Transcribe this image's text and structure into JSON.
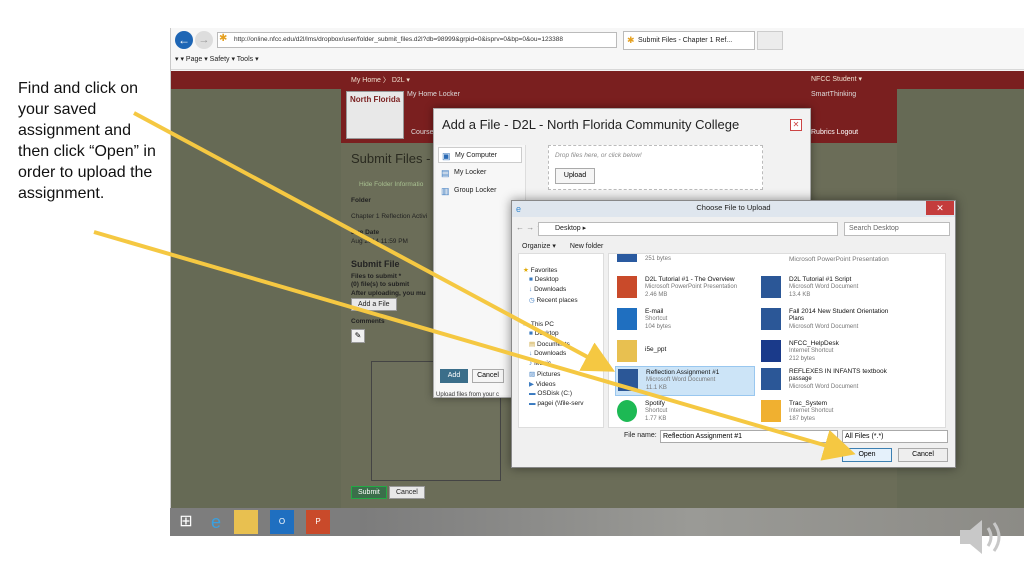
{
  "instruction": "Find and click on your saved assignment and then click “Open” in order to upload the assignment.",
  "browser": {
    "address": "http://online.nfcc.edu/d2l/lms/dropbox/user/folder_submit_files.d2l?db=98999&grpid=0&isprv=0&bp=0&ou=123388",
    "tab_title": "Submit Files - Chapter 1 Ref...",
    "command_bar": "▾  ▾  Page ▾  Safety ▾  Tools ▾"
  },
  "d2l": {
    "top_left": "My Home  〉 D2L  ▾",
    "top_right": "NFCC Student ▾",
    "logo_text": "North Florida",
    "home_locker": "My Home  Locker",
    "smart_thinking": "SmartThinking",
    "course_home": "Course H",
    "rubrics_logout": "Rubrics  Logout",
    "submit_title": "Submit Files - C",
    "hide_folder": "Hide Folder Informatio",
    "folder_label": "Folder",
    "folder_value": "Chapter 1 Reflection Activi",
    "due_label": "Due Date",
    "due_value": "Aug 2014 11:59 PM",
    "submit_files": "Submit File",
    "files_to_submit": "Files to submit *",
    "files_count": "(0) file(s) to submit",
    "after_upload": "After uploading, you mu",
    "add_file": "Add a File",
    "comments": "Comments",
    "submit_btn": "Submit",
    "cancel_btn": "Cancel"
  },
  "add_file_dialog": {
    "title": "Add a File - D2L - North Florida Community College",
    "nav": [
      "My Computer",
      "My Locker",
      "Group Locker"
    ],
    "drop_text": "Drop files here, or click below!",
    "upload": "Upload",
    "add": "Add",
    "cancel": "Cancel",
    "note": "Upload files from your c"
  },
  "choose_dialog": {
    "title": "Choose File to Upload",
    "path": "Desktop  ▸",
    "search_placeholder": "Search Desktop",
    "organize": "Organize ▾",
    "new_folder": "New folder",
    "tree": [
      "Favorites",
      "Desktop",
      "Downloads",
      "Recent places",
      "This PC",
      "Desktop",
      "Documents",
      "Downloads",
      "Music",
      "Pictures",
      "Videos",
      "OSDisk (C:)",
      "pagei (\\\\file-serv"
    ],
    "files_left": [
      {
        "name": "",
        "meta1": "251 bytes",
        "meta2": ""
      },
      {
        "name": "D2L Tutorial #1 - The Overview",
        "meta1": "Microsoft PowerPoint Presentation",
        "meta2": "2.46 MB"
      },
      {
        "name": "E-mail",
        "meta1": "Shortcut",
        "meta2": "104 bytes"
      },
      {
        "name": "i5e_ppt",
        "meta1": "",
        "meta2": ""
      },
      {
        "name": "Reflection Assignment #1",
        "meta1": "Microsoft Word Document",
        "meta2": "11.1 KB"
      },
      {
        "name": "Spotify",
        "meta1": "Shortcut",
        "meta2": "1.77 KB"
      }
    ],
    "files_right": [
      {
        "name": "Microsoft PowerPoint Presentation",
        "meta1": "",
        "meta2": ""
      },
      {
        "name": "D2L Tutorial #1 Script",
        "meta1": "Microsoft Word Document",
        "meta2": "13.4 KB"
      },
      {
        "name": "Fall 2014 New Student Orientation",
        "meta1": "Plans",
        "meta2": "Microsoft Word Document"
      },
      {
        "name": "NFCC_HelpDesk",
        "meta1": "Internet Shortcut",
        "meta2": "212 bytes"
      },
      {
        "name": "REFLEXES IN INFANTS textbook",
        "meta1": "passage",
        "meta2": "Microsoft Word Document"
      },
      {
        "name": "Trac_System",
        "meta1": "Internet Shortcut",
        "meta2": "187 bytes"
      }
    ],
    "file_name_label": "File name:",
    "file_name_value": "Reflection Assignment #1",
    "file_type": "All Files (*.*)",
    "open": "Open",
    "cancel": "Cancel"
  },
  "colors": {
    "accent": "#f5c842",
    "d2l_red": "#7a1f1f",
    "selection": "#cce4f7"
  }
}
